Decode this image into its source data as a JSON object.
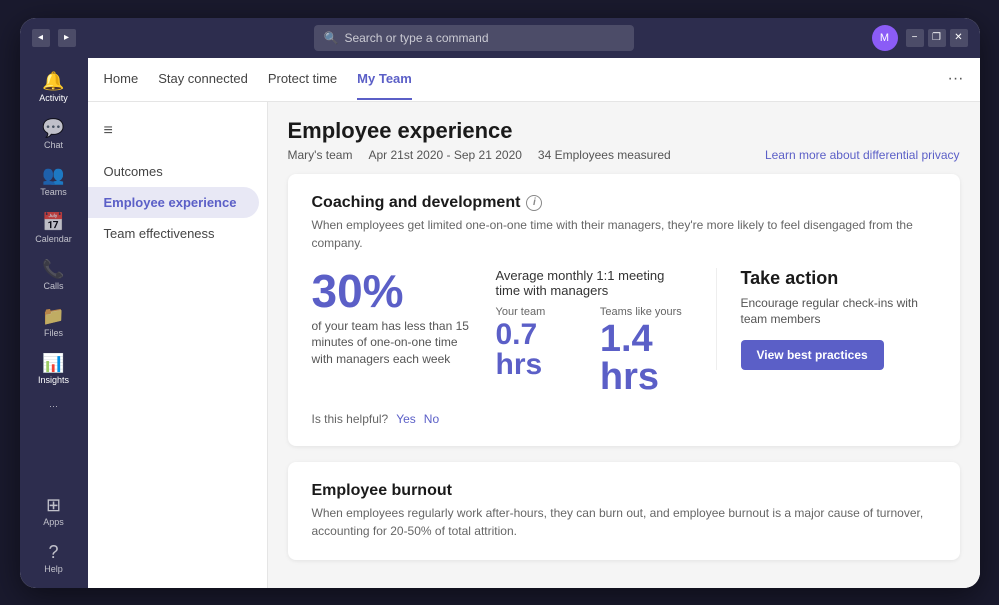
{
  "titlebar": {
    "search_placeholder": "Search or type a command",
    "nav_back": "◂",
    "nav_forward": "▸",
    "win_minimize": "−",
    "win_restore": "❐",
    "win_close": "✕"
  },
  "sidebar": {
    "items": [
      {
        "id": "activity",
        "label": "Activity",
        "icon": "🔔"
      },
      {
        "id": "chat",
        "label": "Chat",
        "icon": "💬"
      },
      {
        "id": "teams",
        "label": "Teams",
        "icon": "👥"
      },
      {
        "id": "calendar",
        "label": "Calendar",
        "icon": "📅"
      },
      {
        "id": "calls",
        "label": "Calls",
        "icon": "📞"
      },
      {
        "id": "files",
        "label": "Files",
        "icon": "📁"
      },
      {
        "id": "insights",
        "label": "Insights",
        "icon": "📊",
        "active": true
      }
    ],
    "more_label": "...",
    "bottom_items": [
      {
        "id": "apps",
        "label": "Apps",
        "icon": "⊞"
      },
      {
        "id": "help",
        "label": "Help",
        "icon": "?"
      }
    ]
  },
  "topnav": {
    "tabs": [
      {
        "id": "home",
        "label": "Home",
        "active": false
      },
      {
        "id": "stay-connected",
        "label": "Stay connected",
        "active": false
      },
      {
        "id": "protect-time",
        "label": "Protect time",
        "active": false
      },
      {
        "id": "my-team",
        "label": "My Team",
        "active": true
      }
    ],
    "more_icon": "···"
  },
  "leftnav": {
    "hamburger": "≡",
    "items": [
      {
        "id": "outcomes",
        "label": "Outcomes",
        "active": false
      },
      {
        "id": "employee-experience",
        "label": "Employee experience",
        "active": true
      },
      {
        "id": "team-effectiveness",
        "label": "Team effectiveness",
        "active": false
      }
    ]
  },
  "page": {
    "title": "Employee experience",
    "meta": {
      "team": "Mary's team",
      "date_range": "Apr 21st 2020 - Sep 21 2020",
      "measured": "34 Employees measured"
    },
    "learn_more": "Learn more about differential privacy",
    "cards": [
      {
        "id": "coaching",
        "title": "Coaching and development",
        "desc": "When employees get limited one-on-one time with their managers, they're more likely to feel disengaged from the company.",
        "big_metric": {
          "number": "30%",
          "label": "of your team has less than 15 minutes of one-on-one time with managers each week"
        },
        "meeting_title": "Average monthly 1:1 meeting time with managers",
        "your_team": {
          "label": "Your team",
          "value": "0.7 hrs"
        },
        "teams_like_yours": {
          "label": "Teams like yours",
          "value": "1.4 hrs"
        },
        "take_action": {
          "title": "Take action",
          "desc": "Encourage regular check-ins with team members",
          "button": "View best practices"
        },
        "helpful": {
          "label": "Is this helpful?",
          "yes": "Yes",
          "no": "No"
        }
      },
      {
        "id": "burnout",
        "title": "Employee burnout",
        "desc": "When employees regularly work after-hours, they can burn out, and employee burnout is a major cause of turnover, accounting for 20-50% of total attrition."
      }
    ]
  }
}
